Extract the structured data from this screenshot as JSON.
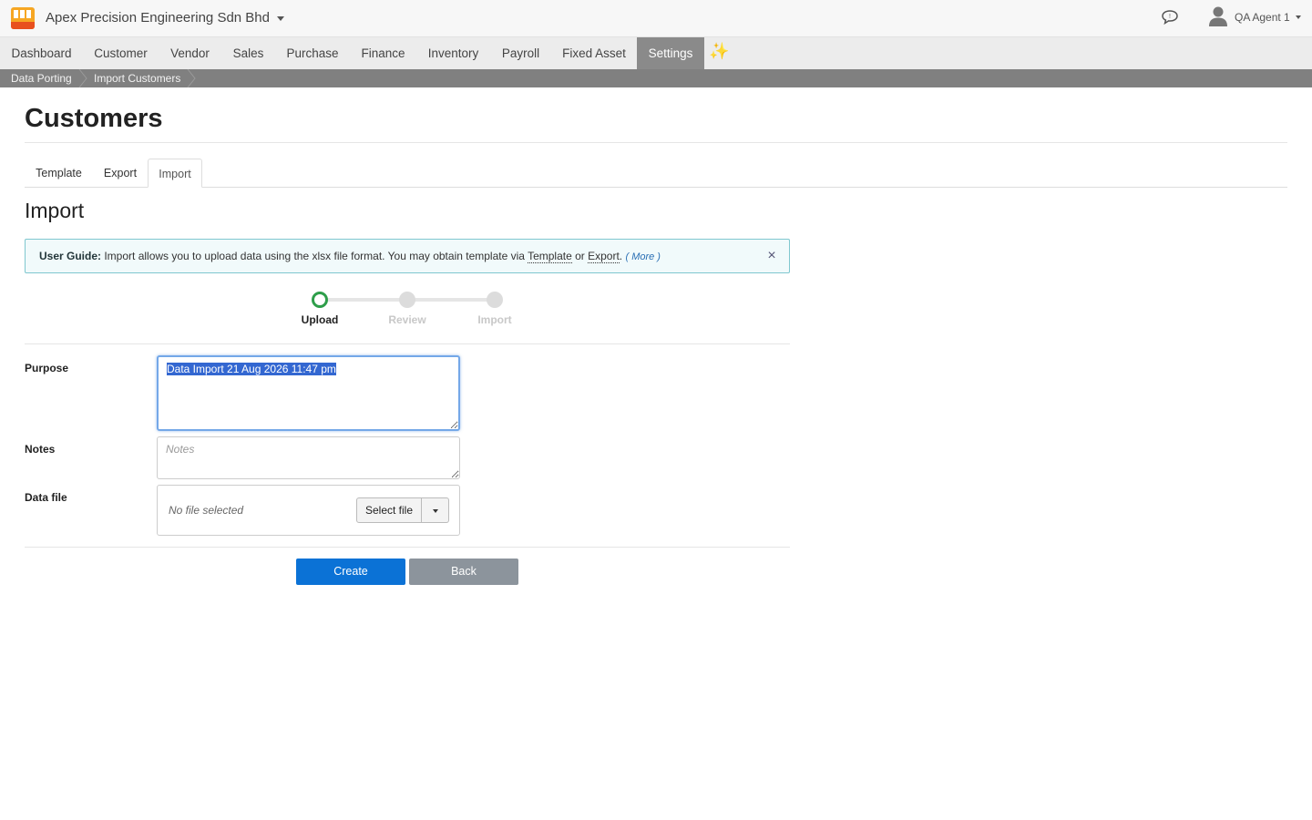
{
  "header": {
    "company": "Apex Precision Engineering Sdn Bhd",
    "user": "QA Agent 1"
  },
  "nav": {
    "items": [
      {
        "label": "Dashboard"
      },
      {
        "label": "Customer"
      },
      {
        "label": "Vendor"
      },
      {
        "label": "Sales"
      },
      {
        "label": "Purchase"
      },
      {
        "label": "Finance"
      },
      {
        "label": "Inventory"
      },
      {
        "label": "Payroll"
      },
      {
        "label": "Fixed Asset"
      },
      {
        "label": "Settings",
        "active": true
      }
    ],
    "sparkle_glyph": "✨"
  },
  "breadcrumb": [
    "Data Porting",
    "Import Customers"
  ],
  "page": {
    "title": "Customers",
    "tabs": [
      {
        "label": "Template"
      },
      {
        "label": "Export"
      },
      {
        "label": "Import",
        "active": true
      }
    ],
    "section_title": "Import"
  },
  "guide": {
    "bold": "User Guide:",
    "text1": " Import allows you to upload data using the xlsx file format. You may obtain template via ",
    "link_template": "Template",
    "text2": " or ",
    "link_export": "Export",
    "text3": ". ",
    "more": "( More )",
    "close": "×"
  },
  "stepper": {
    "steps": [
      {
        "label": "Upload",
        "current": true
      },
      {
        "label": "Review"
      },
      {
        "label": "Import"
      }
    ]
  },
  "form": {
    "purpose_label": "Purpose",
    "purpose_value": "Data Import 21 Aug 2026 11:47 pm",
    "notes_label": "Notes",
    "notes_placeholder": "Notes",
    "datafile_label": "Data file",
    "no_file": "No file selected",
    "select_file": "Select file"
  },
  "actions": {
    "create": "Create",
    "back": "Back"
  },
  "colors": {
    "primary": "#0b72d6",
    "secondary": "#8c949c",
    "step_current": "#2e9e4a",
    "guide_border": "#7fc7cf"
  }
}
